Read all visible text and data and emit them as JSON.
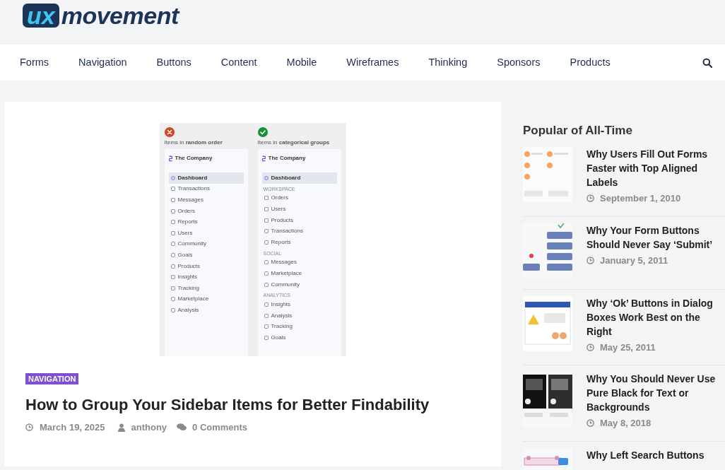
{
  "logo": {
    "mark": "ux",
    "wordmark": "movement"
  },
  "nav": {
    "items": [
      {
        "label": "Forms"
      },
      {
        "label": "Navigation"
      },
      {
        "label": "Buttons"
      },
      {
        "label": "Content"
      },
      {
        "label": "Mobile"
      },
      {
        "label": "Wireframes"
      },
      {
        "label": "Thinking"
      },
      {
        "label": "Sponsors"
      },
      {
        "label": "Products"
      }
    ]
  },
  "featured": {
    "figure": {
      "columns": [
        {
          "kind": "cross",
          "caption": "Items in **random order**",
          "brand": "The Company",
          "groups": [
            {
              "items": [
                {
                  "label": "Dashboard",
                  "selected": true
                },
                {
                  "label": "Transactions",
                  "selected": false
                },
                {
                  "label": "Messages",
                  "selected": false
                },
                {
                  "label": "Orders",
                  "selected": false
                },
                {
                  "label": "Reports",
                  "selected": false
                },
                {
                  "label": "Users",
                  "selected": false
                },
                {
                  "label": "Community",
                  "selected": false
                },
                {
                  "label": "Goals",
                  "selected": false
                },
                {
                  "label": "Products",
                  "selected": false
                },
                {
                  "label": "Insights",
                  "selected": false
                },
                {
                  "label": "Tracking",
                  "selected": false
                },
                {
                  "label": "Marketplace",
                  "selected": false
                },
                {
                  "label": "Analysis",
                  "selected": false
                }
              ]
            }
          ]
        },
        {
          "kind": "check",
          "caption": "Items in **categorical groups**",
          "brand": "The Company",
          "groups": [
            {
              "items": [
                {
                  "label": "Dashboard",
                  "selected": true
                }
              ]
            },
            {
              "heading": "WORKSPACE",
              "items": [
                {
                  "label": "Orders",
                  "selected": false
                },
                {
                  "label": "Users",
                  "selected": false
                },
                {
                  "label": "Products",
                  "selected": false
                },
                {
                  "label": "Transactions",
                  "selected": false
                },
                {
                  "label": "Reports",
                  "selected": false
                }
              ]
            },
            {
              "heading": "SOCIAL",
              "items": [
                {
                  "label": "Messages",
                  "selected": false
                },
                {
                  "label": "Marketplace",
                  "selected": false
                },
                {
                  "label": "Community",
                  "selected": false
                }
              ]
            },
            {
              "heading": "ANALYTICS",
              "items": [
                {
                  "label": "Insights",
                  "selected": false
                },
                {
                  "label": "Analysis",
                  "selected": false
                },
                {
                  "label": "Tracking",
                  "selected": false
                },
                {
                  "label": "Goals",
                  "selected": false
                }
              ]
            }
          ]
        }
      ]
    },
    "category": "NAVIGATION",
    "title": "How to Group Your Sidebar Items for Better Findability",
    "date": "March 19, 2025",
    "author": "anthony",
    "comments": "0 Comments"
  },
  "sidebar": {
    "title": "Popular of All-Time",
    "posts": [
      {
        "title": "Why Users Fill Out Forms Faster with Top Aligned Labels",
        "date": "September 1, 2010"
      },
      {
        "title": "Why Your Form Buttons Should Never Say ‘Submit’",
        "date": "January 5, 2011"
      },
      {
        "title": "Why ‘Ok’ Buttons in Dialog Boxes Work Best on the Right",
        "date": "May 25, 2011"
      },
      {
        "title": "Why You Should Never Use Pure Black for Text or Backgrounds",
        "date": "May 8, 2018"
      },
      {
        "title": "Why Left Search Buttons"
      }
    ]
  }
}
